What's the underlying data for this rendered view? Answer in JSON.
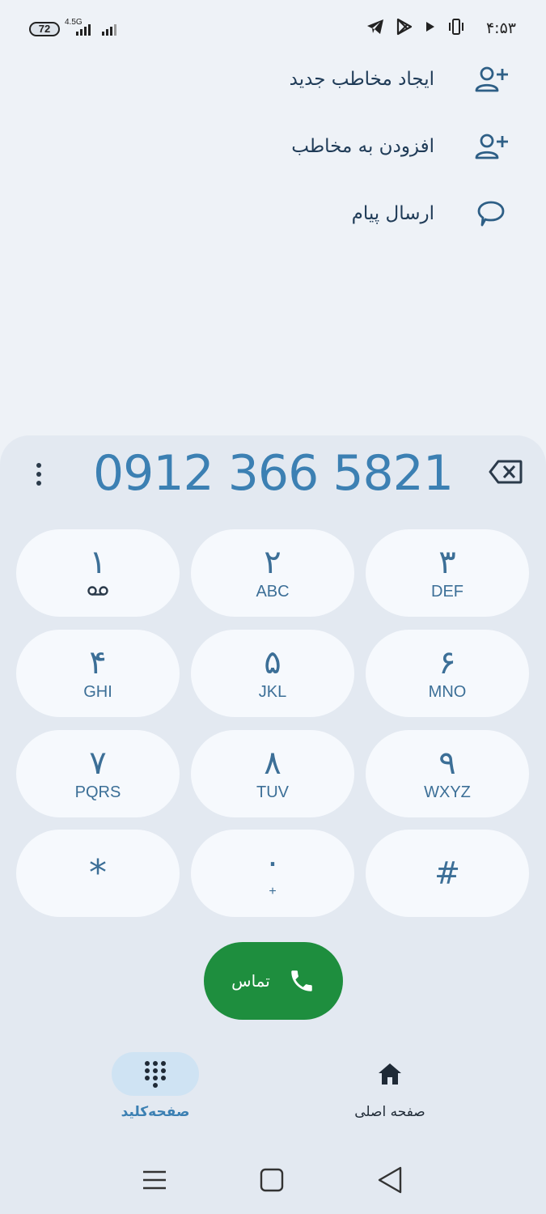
{
  "status_bar": {
    "battery": "72",
    "network": "4.5G",
    "time": "۴:۵۳"
  },
  "actions": [
    {
      "label": "ایجاد مخاطب جدید",
      "icon": "person-add-icon"
    },
    {
      "label": "افزودن به مخاطب",
      "icon": "person-add-icon"
    },
    {
      "label": "ارسال پیام",
      "icon": "message-icon"
    }
  ],
  "dialer": {
    "number": "0912 366 5821",
    "keys": [
      {
        "digit": "۱",
        "letters": "",
        "extra": "voicemail-icon"
      },
      {
        "digit": "۲",
        "letters": "ABC"
      },
      {
        "digit": "۳",
        "letters": "DEF"
      },
      {
        "digit": "۴",
        "letters": "GHI"
      },
      {
        "digit": "۵",
        "letters": "JKL"
      },
      {
        "digit": "۶",
        "letters": "MNO"
      },
      {
        "digit": "۷",
        "letters": "PQRS"
      },
      {
        "digit": "۸",
        "letters": "TUV"
      },
      {
        "digit": "۹",
        "letters": "WXYZ"
      },
      {
        "digit": "*",
        "letters": ""
      },
      {
        "digit": "۰",
        "letters": "+"
      },
      {
        "digit": "#",
        "letters": ""
      }
    ],
    "call_label": "تماس"
  },
  "bottom_nav": {
    "keypad_label": "صفحه‌کلید",
    "home_label": "صفحه اصلی"
  },
  "colors": {
    "accent": "#3c80b3",
    "call_green": "#1e8e3e",
    "background": "#eef2f7",
    "key_bg": "#f6f9fd"
  }
}
